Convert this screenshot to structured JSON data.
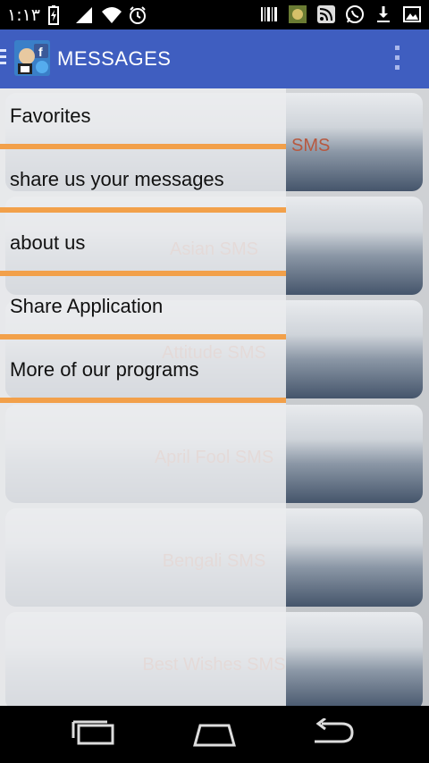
{
  "status_bar": {
    "time": "١:١٣",
    "icons": [
      "battery-icon",
      "signal-icon",
      "wifi-icon",
      "alarm-icon",
      "barcode-icon",
      "app-icon",
      "rss-icon",
      "whatsapp-icon",
      "download-icon",
      "image-icon"
    ]
  },
  "action_bar": {
    "title": "MESSAGES",
    "color": "#3f5ec0"
  },
  "cards": [
    {
      "label": "SMS"
    },
    {
      "label": "Asian SMS"
    },
    {
      "label": "Attitude SMS"
    },
    {
      "label": "April Fool SMS"
    },
    {
      "label": "Bengali SMS"
    },
    {
      "label": "Best Wishes SMS"
    }
  ],
  "drawer": {
    "items": [
      {
        "label": "Favorites"
      },
      {
        "label": "share us your messages"
      },
      {
        "label": "about us"
      },
      {
        "label": "Share Application"
      },
      {
        "label": "More of our programs"
      }
    ],
    "divider_color": "#f2a04a"
  },
  "nav_bar": {
    "buttons": [
      "recent-apps-icon",
      "home-icon",
      "back-icon"
    ]
  }
}
